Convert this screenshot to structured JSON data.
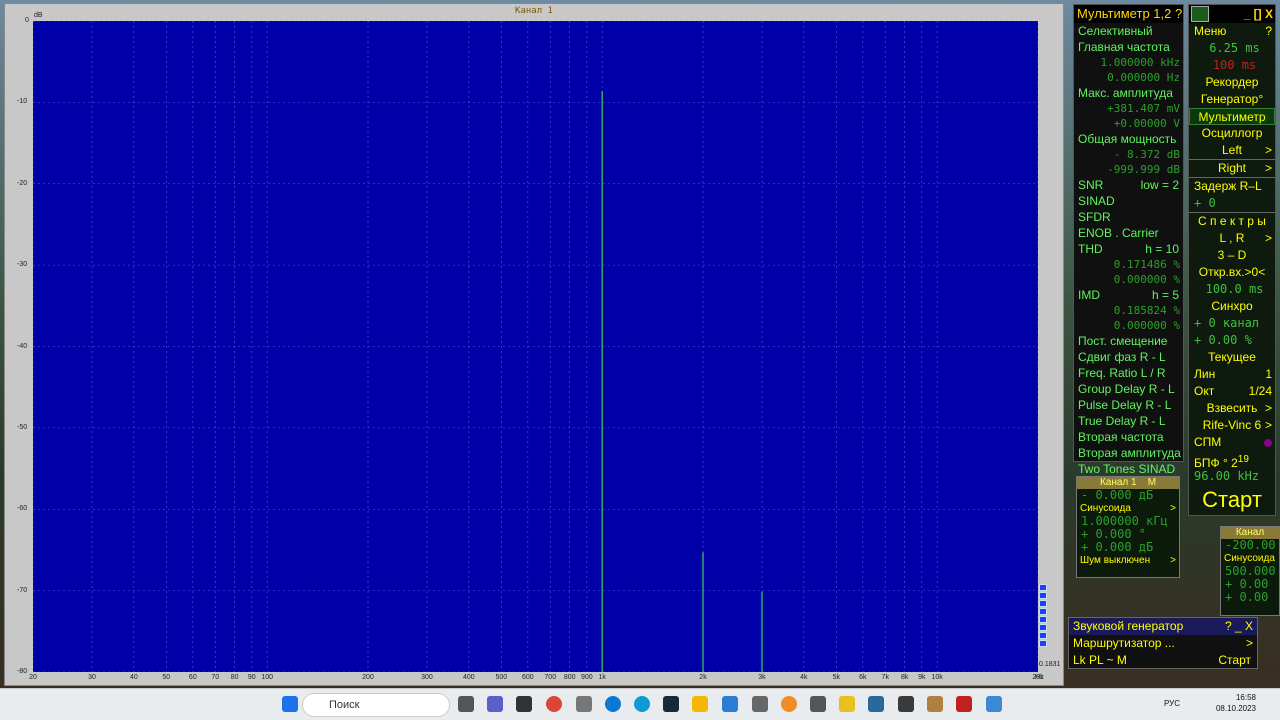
{
  "spectrum": {
    "channel_title": "Канал 1",
    "y_unit": "dB",
    "x_unit": "Hz",
    "freq_corner": "0.1831",
    "y_ticks": [
      "0",
      "-10",
      "-20",
      "-30",
      "-40",
      "-50",
      "-60",
      "-70",
      "-80"
    ],
    "x_ticks": [
      "20",
      "30",
      "40",
      "50",
      "60",
      "70",
      "80",
      "90",
      "100",
      "200",
      "300",
      "400",
      "500",
      "600",
      "700",
      "800",
      "900",
      "1k",
      "2k",
      "3k",
      "4k",
      "5k",
      "6k",
      "7k",
      "8k",
      "9k",
      "10k",
      "20k"
    ]
  },
  "chart_data": {
    "type": "bar",
    "title": "Канал 1",
    "xlabel": "Hz",
    "ylabel": "dB",
    "x_scale": "log",
    "xlim": [
      20,
      20000
    ],
    "ylim": [
      -80,
      0
    ],
    "grid": true,
    "series": [
      {
        "x": [
          1000,
          2000,
          3000
        ],
        "values": [
          -8.6,
          -65.3,
          -70.1
        ]
      }
    ]
  },
  "multimeter": {
    "title": "Мультиметр 1,2 ?",
    "rows": [
      {
        "label": "Селективный",
        "value": ""
      },
      {
        "label": "Главная частота",
        "value": ""
      },
      {
        "label": "",
        "value": "1.000000 kHz"
      },
      {
        "label": "",
        "value": "0.000000 Hz"
      },
      {
        "label": "Макс. амплитуда",
        "value": ""
      },
      {
        "label": "",
        "value": "+381.407 mV"
      },
      {
        "label": "",
        "value": "+0.00000 V"
      },
      {
        "label": "Общая мощность",
        "value": ""
      },
      {
        "label": "",
        "value": "- 8.372 dB"
      },
      {
        "label": "",
        "value": "-999.999 dB"
      },
      {
        "label": "SNR",
        "value": "low = 2"
      },
      {
        "label": "SINAD",
        "value": ""
      },
      {
        "label": "SFDR",
        "value": ""
      },
      {
        "label": "ENOB . Carrier",
        "value": ""
      },
      {
        "label": "THD",
        "value": "h = 10"
      },
      {
        "label": "",
        "value": "0.171486 %"
      },
      {
        "label": "",
        "value": "0.000000 %"
      },
      {
        "label": "IMD",
        "value": "h = 5"
      },
      {
        "label": "",
        "value": "0.185824 %"
      },
      {
        "label": "",
        "value": "0.000000 %"
      },
      {
        "label": "Пост. смещение",
        "value": ""
      },
      {
        "label": "Сдвиг фаз R - L",
        "value": ""
      },
      {
        "label": "Freq. Ratio L / R",
        "value": ""
      },
      {
        "label": "Group Delay R - L",
        "value": ""
      },
      {
        "label": "Pulse Delay R - L",
        "value": ""
      },
      {
        "label": "True Delay R - L",
        "value": ""
      },
      {
        "label": "Вторая частота",
        "value": ""
      },
      {
        "label": "Вторая амплитуда",
        "value": ""
      },
      {
        "label": "Two Tones SINAD",
        "value": ""
      }
    ]
  },
  "control_panel": {
    "controls": "_ [] X",
    "menu": "Меню",
    "menu_q": "?",
    "time1": "6.25 ms",
    "time2": "100 ms",
    "recorder": "Рекордер",
    "generator": "Генератор°",
    "multimeter": "Мультиметр",
    "oscillograph": "Осциллогр",
    "left": "Left",
    "right": "Right",
    "delay": "Задерж R–L",
    "delay_val": "+ 0",
    "spectra": "С п е к т р ы",
    "lr": "L , R",
    "three_d": "3 – D",
    "open_input": "Откр.вх.>0<",
    "open_ms": "100.0 ms",
    "sync": "Синхро",
    "sync_ch": "+ 0 канал",
    "sync_pct": "+ 0.00 %",
    "current": "Текущее",
    "lin": "Лин",
    "lin_val": "1",
    "oct": "Окт",
    "oct_val": "1/24",
    "weigh": "Взвесить",
    "window": "Rife-Vinc 6",
    "spm": "СПМ",
    "fft": "БПФ ° 2",
    "fft_exp": "19",
    "rate": "96.00 kHz",
    "start": "Старт"
  },
  "gen_ch1": {
    "title": "Канал 1",
    "mode": "M",
    "level": "- 0.000 дБ",
    "wave": "Синусоида",
    "freq": "1.000000 кГц",
    "phase": "+ 0.000 °",
    "gain": "+ 0.000 дБ",
    "noise": "Шум выключен"
  },
  "gen_ch2": {
    "title": "Канал",
    "level": "-200.00",
    "wave": "Синусоида",
    "freq": "500.000",
    "phase": "+ 0.00",
    "gain": "+ 0.00"
  },
  "sound_gen": {
    "title": "Звуковой генератор",
    "title_ctl": "? _ X",
    "router": "Маршрутизатор ...",
    "lk": "Lk PL ~ M",
    "start": "Старт"
  },
  "taskbar": {
    "search_placeholder": "Поиск",
    "lang": "РУС",
    "time": "16:58",
    "date": "08.10.2023"
  }
}
